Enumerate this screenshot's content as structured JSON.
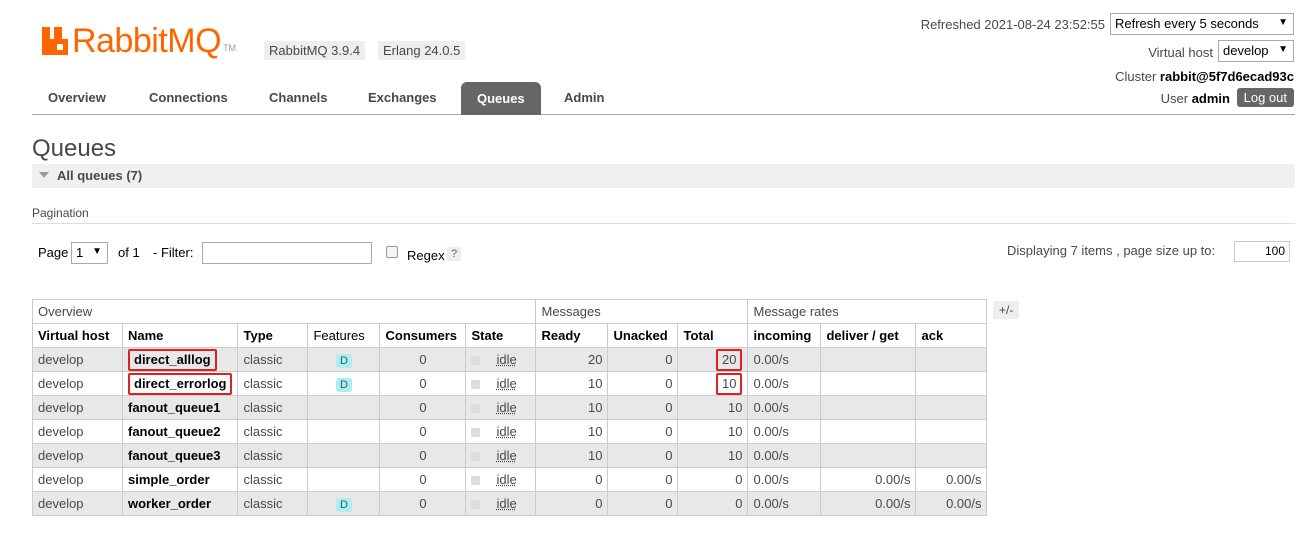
{
  "header": {
    "logo_rabbit": "Rabbit",
    "logo_mq": "MQ",
    "logo_tm": "TM",
    "rabbitmq_version": "RabbitMQ 3.9.4",
    "erlang_version": "Erlang 24.0.5",
    "refreshed": "Refreshed 2021-08-24 23:52:55",
    "refresh_select": "Refresh every 5 seconds",
    "virtual_host_label": "Virtual host",
    "virtual_host_value": "develop",
    "cluster_label": "Cluster",
    "cluster_value": "rabbit@5f7d6ecad93c",
    "user_label": "User",
    "user_value": "admin",
    "logout": "Log out"
  },
  "tabs": [
    "Overview",
    "Connections",
    "Channels",
    "Exchanges",
    "Queues",
    "Admin"
  ],
  "active_tab": "Queues",
  "page_title": "Queues",
  "section_title": "All queues (7)",
  "pagination": {
    "label": "Pagination",
    "page_label": "Page",
    "page_value": "1",
    "of_label": "of 1",
    "filter_label": "- Filter:",
    "filter_value": "",
    "regex_label": "Regex",
    "help": "?",
    "displaying": "Displaying 7 items , page size up to:",
    "page_size": "100"
  },
  "table": {
    "groups": [
      "Overview",
      "Messages",
      "Message rates"
    ],
    "columns": [
      "Virtual host",
      "Name",
      "Type",
      "Features",
      "Consumers",
      "State",
      "Ready",
      "Unacked",
      "Total",
      "incoming",
      "deliver / get",
      "ack"
    ],
    "plus_minus": "+/-",
    "rows": [
      {
        "vhost": "develop",
        "name": "direct_alllog",
        "type": "classic",
        "features": "D",
        "consumers": "0",
        "state": "idle",
        "ready": "20",
        "unacked": "0",
        "total": "20",
        "incoming": "0.00/s",
        "deliver": "",
        "ack": ""
      },
      {
        "vhost": "develop",
        "name": "direct_errorlog",
        "type": "classic",
        "features": "D",
        "consumers": "0",
        "state": "idle",
        "ready": "10",
        "unacked": "0",
        "total": "10",
        "incoming": "0.00/s",
        "deliver": "",
        "ack": ""
      },
      {
        "vhost": "develop",
        "name": "fanout_queue1",
        "type": "classic",
        "features": "",
        "consumers": "0",
        "state": "idle",
        "ready": "10",
        "unacked": "0",
        "total": "10",
        "incoming": "0.00/s",
        "deliver": "",
        "ack": ""
      },
      {
        "vhost": "develop",
        "name": "fanout_queue2",
        "type": "classic",
        "features": "",
        "consumers": "0",
        "state": "idle",
        "ready": "10",
        "unacked": "0",
        "total": "10",
        "incoming": "0.00/s",
        "deliver": "",
        "ack": ""
      },
      {
        "vhost": "develop",
        "name": "fanout_queue3",
        "type": "classic",
        "features": "",
        "consumers": "0",
        "state": "idle",
        "ready": "10",
        "unacked": "0",
        "total": "10",
        "incoming": "0.00/s",
        "deliver": "",
        "ack": ""
      },
      {
        "vhost": "develop",
        "name": "simple_order",
        "type": "classic",
        "features": "",
        "consumers": "0",
        "state": "idle",
        "ready": "0",
        "unacked": "0",
        "total": "0",
        "incoming": "0.00/s",
        "deliver": "0.00/s",
        "ack": "0.00/s"
      },
      {
        "vhost": "develop",
        "name": "worker_order",
        "type": "classic",
        "features": "D",
        "consumers": "0",
        "state": "idle",
        "ready": "0",
        "unacked": "0",
        "total": "0",
        "incoming": "0.00/s",
        "deliver": "0.00/s",
        "ack": "0.00/s"
      }
    ]
  },
  "colors": {
    "brand": "#ff6600",
    "highlight": "#e02020",
    "active_tab": "#666666",
    "feature_badge": "#aaeeee"
  }
}
